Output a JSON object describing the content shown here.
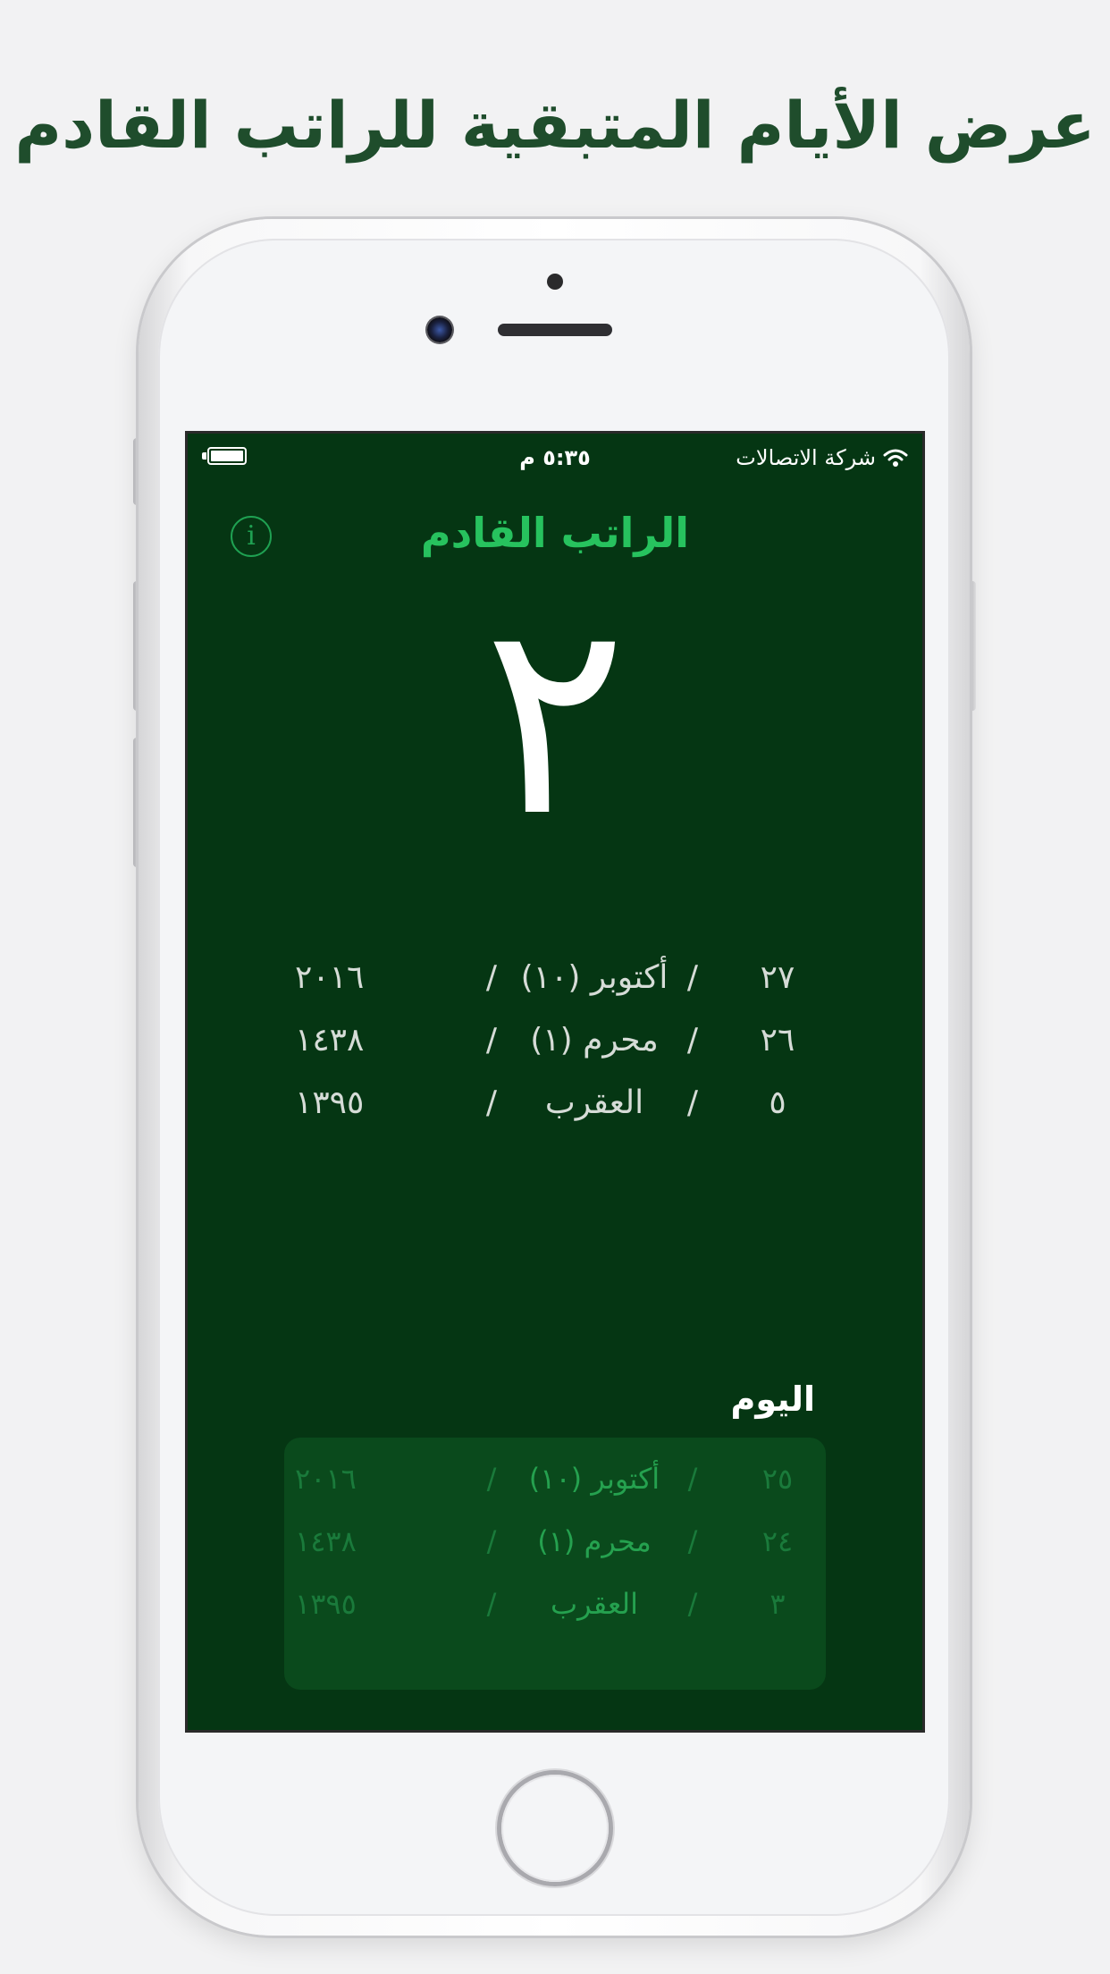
{
  "headline": "عرض الأيام المتبقية للراتب القادم",
  "status_bar": {
    "time": "٥:٣٥ م",
    "carrier": "شركة الاتصالات"
  },
  "screen": {
    "title": "الراتب القادم",
    "days_remaining": "٢",
    "separator": "/",
    "next_payday": [
      {
        "day": "٢٧",
        "month": "أكتوبر (١٠)",
        "year": "٢٠١٦"
      },
      {
        "day": "٢٦",
        "month": "محرم (١)",
        "year": "١٤٣٨"
      },
      {
        "day": "٥",
        "month": "العقرب",
        "year": "١٣٩٥"
      }
    ],
    "today_label": "اليوم",
    "today": [
      {
        "day": "٢٥",
        "month": "أكتوبر (١٠)",
        "year": "٢٠١٦"
      },
      {
        "day": "٢٤",
        "month": "محرم (١)",
        "year": "١٤٣٨"
      },
      {
        "day": "٣",
        "month": "العقرب",
        "year": "١٣٩٥"
      }
    ]
  },
  "colors": {
    "screen_background": "#053613",
    "title_green": "#27c25e",
    "headline_green": "#1f4d2c"
  },
  "icons": {
    "info": "info-icon",
    "wifi": "wifi-icon",
    "battery": "battery-icon"
  }
}
